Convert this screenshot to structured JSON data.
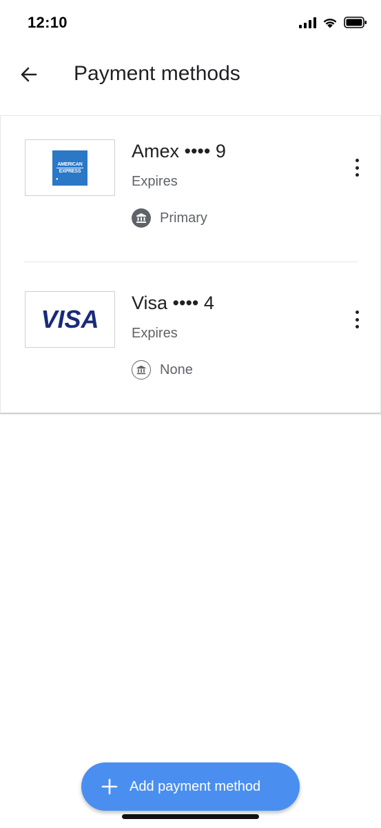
{
  "status_bar": {
    "time": "12:10",
    "icons": [
      "signal-icon",
      "wifi-icon",
      "battery-icon"
    ]
  },
  "header": {
    "back_icon": "arrow-left-icon",
    "title": "Payment methods"
  },
  "payment_methods": [
    {
      "brand": "amex",
      "logo_text": [
        "AMERICAN",
        "EXPRESS"
      ],
      "name": "Amex •••• 9",
      "expires_label": "Expires",
      "bank_icon": "bank-icon-filled",
      "bank_label": "Primary",
      "menu_icon": "more-vertical-icon"
    },
    {
      "brand": "visa",
      "logo_text": "VISA",
      "name": "Visa •••• 4",
      "expires_label": "Expires",
      "bank_icon": "bank-icon-outline",
      "bank_label": "None",
      "menu_icon": "more-vertical-icon"
    }
  ],
  "fab": {
    "icon": "plus-icon",
    "label": "Add payment method"
  },
  "colors": {
    "accent": "#4a8ff0",
    "amex_blue": "#2a78c6",
    "visa_navy": "#1a2b7a",
    "secondary_text": "#5f6368"
  }
}
